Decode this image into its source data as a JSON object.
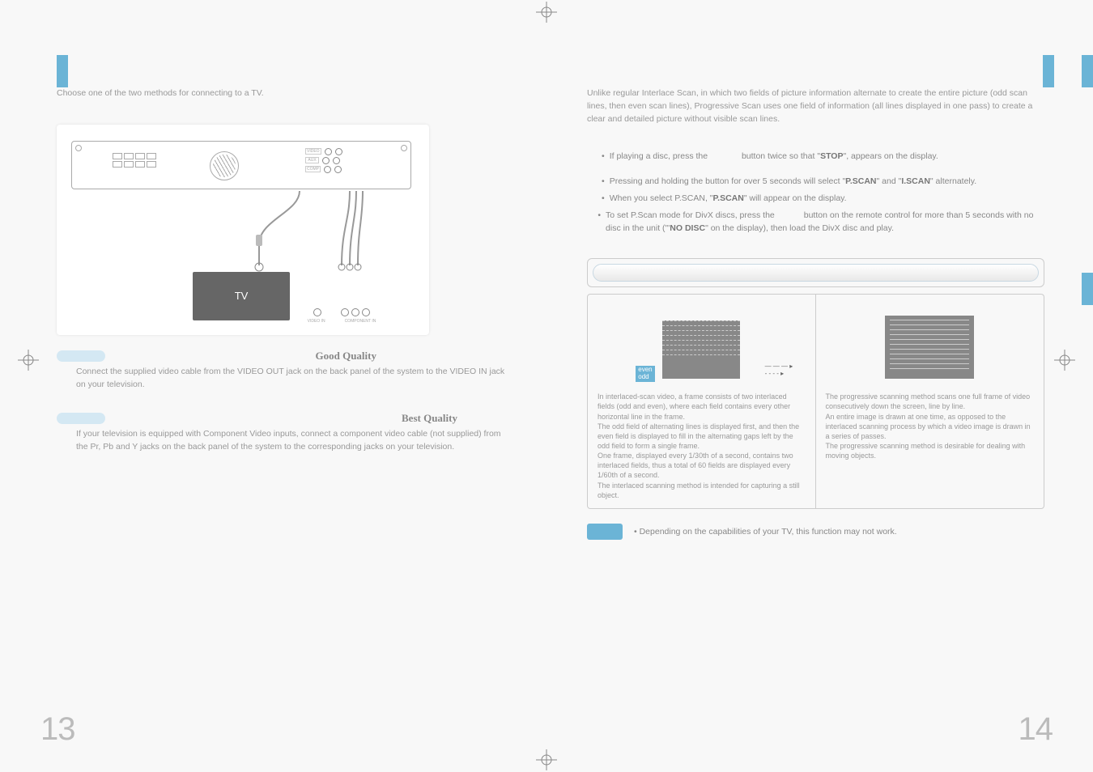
{
  "left": {
    "intro": "Choose one of the two methods for connecting to a TV.",
    "tv_label": "TV",
    "tv_port_left": "VIDEO\nIN",
    "tv_port_right": "COMPONENT\nIN",
    "method1": {
      "quality": "Good Quality",
      "text": "Connect the supplied video cable from the VIDEO OUT jack on the back panel of the system to the VIDEO IN jack on your television."
    },
    "method2": {
      "quality": "Best Quality",
      "text": "If your television is equipped with Component Video inputs, connect a component video cable (not supplied) from the Pr, Pb and Y jacks on the back panel of the system to the corresponding jacks on your television."
    },
    "page_number": "13"
  },
  "right": {
    "intro": "Unlike regular Interlace Scan, in which two fields of picture information alternate to create the entire picture (odd scan lines, then even scan lines), Progressive Scan uses one field of information (all lines displayed in one pass) to create a clear and detailed picture without visible scan lines.",
    "step1_a": "If playing a disc, press the",
    "step1_b": "button twice so that \"",
    "step1_bold": "STOP",
    "step1_c": "\", appears on the display.",
    "b1_a": "Pressing and holding the button for over 5 seconds will select \"",
    "b1_bold1": "P.SCAN",
    "b1_mid": "\" and \"",
    "b1_bold2": "I.SCAN",
    "b1_end": "\" alternately.",
    "b2_a": "When you select P.SCAN, \"",
    "b2_bold": "P.SCAN",
    "b2_end": "\" will appear on the display.",
    "b3_a": "To set P.Scan mode for DivX discs, press the",
    "b3_b": "button on the remote control for more than 5 seconds with no disc in the unit (\"'",
    "b3_bold": "NO DISC",
    "b3_c": "\" on the display), then load the DivX disc and play.",
    "interlaced_tag_even": "even",
    "interlaced_tag_odd": "odd",
    "interlaced_desc": "In interlaced-scan video, a frame consists of two interlaced fields (odd and even), where each field contains every other horizontal line in the frame.\nThe odd field of alternating lines is displayed first, and then the even field is displayed to fill in the alternating gaps left by the odd field to form a single frame.\nOne frame, displayed every 1/30th of a second, contains two interlaced fields, thus a total of 60 fields are displayed every 1/60th of a second.\nThe interlaced scanning method is intended for capturing a still object.",
    "progressive_desc": "The progressive scanning method scans one full frame of video consecutively down the screen, line by line.\nAn entire image is drawn at one time, as opposed to the interlaced scanning process by which a video image is drawn in a series of passes.\nThe progressive scanning method is desirable for dealing with moving objects.",
    "note": "Depending on the capabilities of your TV, this function may not work.",
    "page_number": "14"
  }
}
